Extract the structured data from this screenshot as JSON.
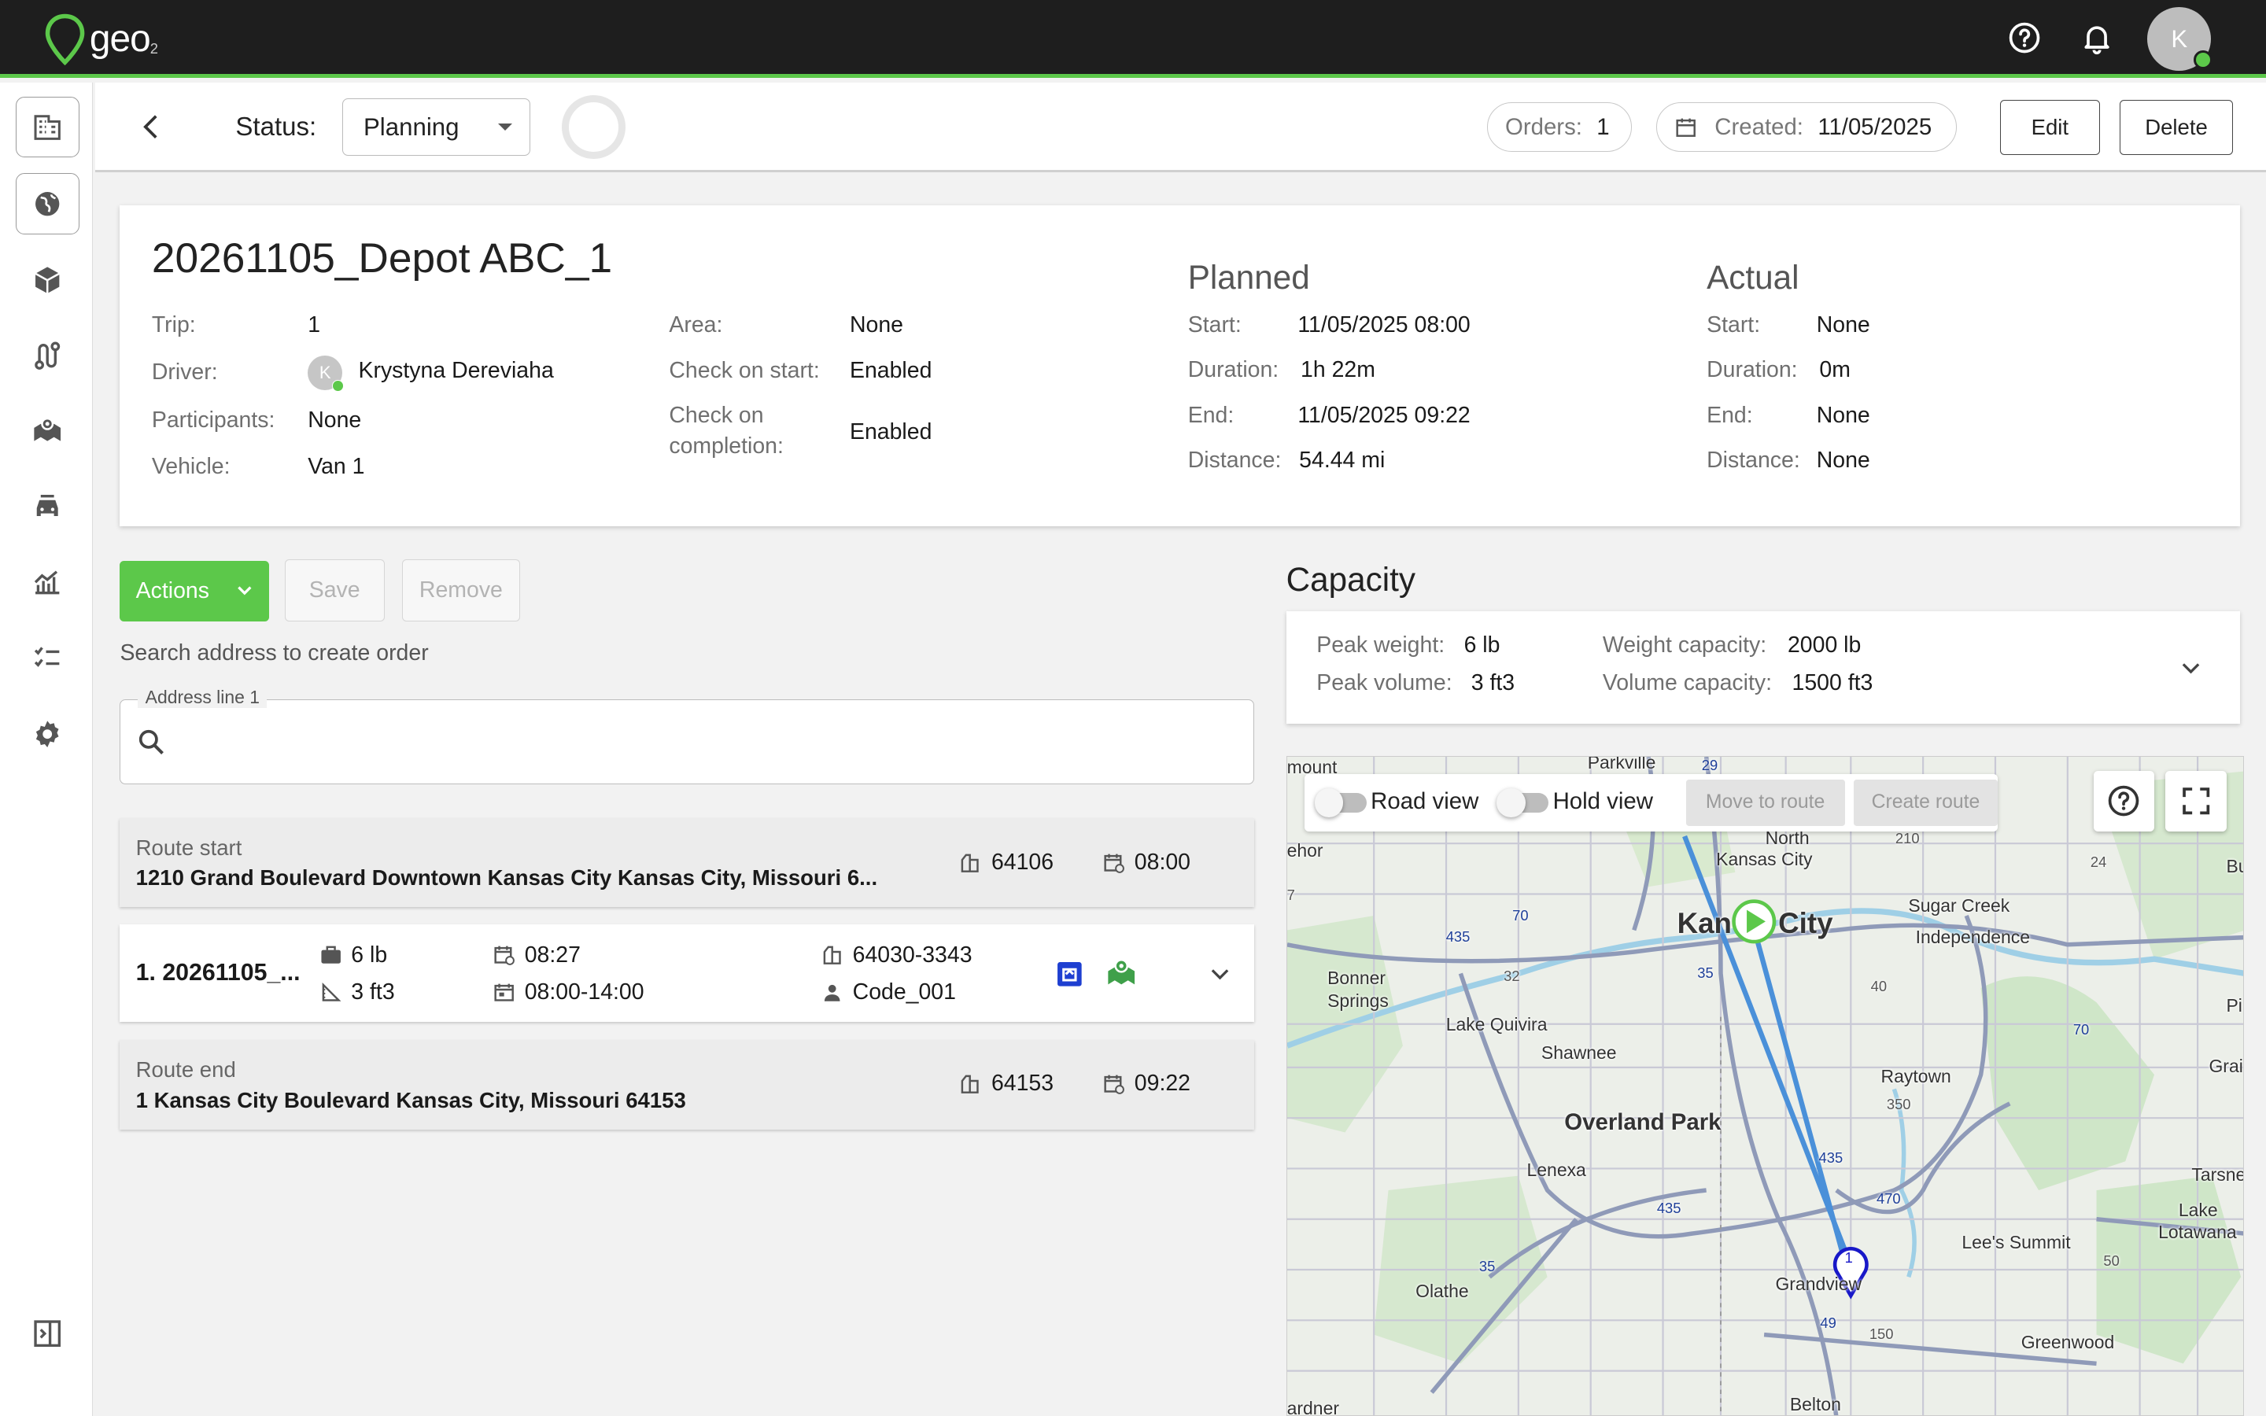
{
  "app": {
    "logo_text": "geo",
    "logo_sub": "2",
    "user_initial": "K"
  },
  "icons": {
    "help": "help-circle-icon",
    "bell": "bell-icon",
    "back": "arrow-left-icon",
    "sidebar": [
      "buildings-icon",
      "globe-icon",
      "package-icon",
      "route-icon",
      "map-pin-icon",
      "car-icon",
      "chart-icon",
      "checklist-icon",
      "gear-icon",
      "collapse-sidebar-icon"
    ]
  },
  "header": {
    "status_label": "Status:",
    "status_value": "Planning",
    "orders_label": "Orders:",
    "orders_value": "1",
    "created_label": "Created:",
    "created_value": "11/05/2025",
    "edit_label": "Edit",
    "delete_label": "Delete"
  },
  "trip": {
    "title": "20261105_Depot ABC_1",
    "trip_label": "Trip:",
    "trip_value": "1",
    "driver_label": "Driver:",
    "driver_initial": "K",
    "driver_value": "Krystyna Dereviaha",
    "participants_label": "Participants:",
    "participants_value": "None",
    "vehicle_label": "Vehicle:",
    "vehicle_value": "Van 1",
    "area_label": "Area:",
    "area_value": "None",
    "check_start_label": "Check on start:",
    "check_start_value": "Enabled",
    "check_completion_label_1": "Check on",
    "check_completion_label_2": "completion:",
    "check_completion_value": "Enabled"
  },
  "planned": {
    "title": "Planned",
    "start_label": "Start:",
    "start_value": "11/05/2025 08:00",
    "duration_label": "Duration:",
    "duration_value": "1h 22m",
    "end_label": "End:",
    "end_value": "11/05/2025 09:22",
    "distance_label": "Distance:",
    "distance_value": "54.44 mi"
  },
  "actual": {
    "title": "Actual",
    "start_label": "Start:",
    "start_value": "None",
    "duration_label": "Duration:",
    "duration_value": "0m",
    "end_label": "End:",
    "end_value": "None",
    "distance_label": "Distance:",
    "distance_value": "None"
  },
  "actions": {
    "actions_label": "Actions",
    "save_label": "Save",
    "remove_label": "Remove"
  },
  "search": {
    "hint": "Search address to create order",
    "legend": "Address line 1",
    "placeholder": ""
  },
  "route": {
    "start": {
      "label": "Route start",
      "address": "1210 Grand Boulevard Downtown Kansas City Kansas City, Missouri 6...",
      "zip": "64106",
      "time": "08:00"
    },
    "stops": [
      {
        "name": "1. 20261105_...",
        "weight": "6 lb",
        "volume": "3 ft3",
        "eta": "08:27",
        "window": "08:00-14:00",
        "zip": "64030-3343",
        "code": "Code_001"
      }
    ],
    "end": {
      "label": "Route end",
      "address": "1 Kansas City Boulevard Kansas City, Missouri 64153",
      "zip": "64153",
      "time": "09:22"
    }
  },
  "capacity": {
    "title": "Capacity",
    "peak_weight_label": "Peak weight:",
    "peak_weight_value": "6 lb",
    "peak_volume_label": "Peak volume:",
    "peak_volume_value": "3 ft3",
    "weight_capacity_label": "Weight capacity:",
    "weight_capacity_value": "2000 lb",
    "volume_capacity_label": "Volume capacity:",
    "volume_capacity_value": "1500 ft3"
  },
  "map": {
    "road_view_label": "Road view",
    "hold_view_label": "Hold view",
    "move_to_route_label": "Move to route",
    "create_route_label": "Create route",
    "stop_marker": "1",
    "labels": {
      "parkville": "Parkville",
      "north_kc": "North",
      "kansas_city_small": "Kansas City",
      "kc_left": "Kan",
      "kc_right": "City",
      "sugar_creek": "Sugar Creek",
      "independence": "Independence",
      "bonner": "Bonner",
      "springs": "Springs",
      "lake_quivira": "Lake Quivira",
      "shawnee": "Shawnee",
      "raytown": "Raytown",
      "overland_park": "Overland Park",
      "lenexa": "Lenexa",
      "lees_summit": "Lee's Summit",
      "grandview": "Grandview",
      "olathe": "Olathe",
      "greenwood": "Greenwood",
      "belton": "Belton",
      "lake_lotawana_1": "Lake",
      "lake_lotawana_2": "Lotawana",
      "tarsney": "Tarsne",
      "grain": "Grai",
      "pi": "Pi",
      "bu": "Bu",
      "ehor": "ehor",
      "mount": "mount",
      "ardner": "ardner",
      "hw_29": "29",
      "hw_70a": "70",
      "hw_435a": "435",
      "hw_32": "32",
      "hw_35a": "35",
      "hw_40": "40",
      "hw_70b": "70",
      "hw_350": "350",
      "hw_435b": "435",
      "hw_435c": "435",
      "hw_470": "470",
      "hw_35b": "35",
      "hw_50": "50",
      "hw_49": "49",
      "hw_150": "150",
      "hw_24": "24",
      "hw_210": "210",
      "hw_7": "7"
    }
  }
}
